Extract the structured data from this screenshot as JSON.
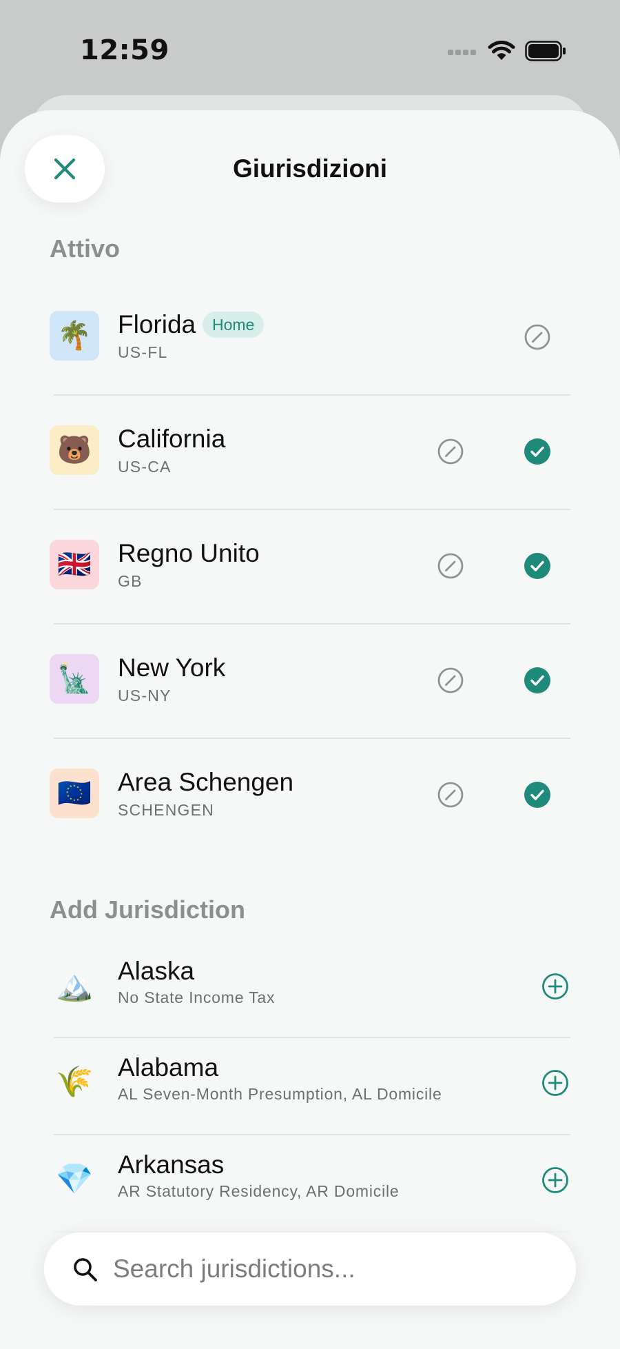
{
  "status_bar": {
    "time": "12:59"
  },
  "sheet": {
    "title": "Giurisdizioni"
  },
  "active_section": {
    "header": "Attivo",
    "items": [
      {
        "name": "Florida",
        "code": "US-FL",
        "badge": "Home",
        "icon": "🌴",
        "tile_color": "#cfe6f8",
        "checked": false
      },
      {
        "name": "California",
        "code": "US-CA",
        "icon": "🐻",
        "tile_color": "#fbeec6",
        "checked": true
      },
      {
        "name": "Regno Unito",
        "code": "GB",
        "icon": "🇬🇧",
        "tile_color": "#fbd7db",
        "checked": true
      },
      {
        "name": "New York",
        "code": "US-NY",
        "icon": "🗽",
        "tile_color": "#ecd8f3",
        "checked": true
      },
      {
        "name": "Area Schengen",
        "code": "SCHENGEN",
        "icon": "🇪🇺",
        "tile_color": "#fce1cf",
        "checked": true
      }
    ]
  },
  "add_section": {
    "header": "Add Jurisdiction",
    "items": [
      {
        "name": "Alaska",
        "subtitle": "No State Income Tax",
        "icon": "🏔️"
      },
      {
        "name": "Alabama",
        "subtitle": "AL Seven-Month Presumption, AL Domicile",
        "icon": "🌾"
      },
      {
        "name": "Arkansas",
        "subtitle": "AR Statutory Residency, AR Domicile",
        "icon": "💎"
      }
    ]
  },
  "search": {
    "placeholder": "Search jurisdictions..."
  },
  "colors": {
    "accent": "#1f8a7a",
    "muted_icon": "#8e9496",
    "badge_bg": "#d7eeea",
    "sheet_bg": "#f6f8f8"
  }
}
